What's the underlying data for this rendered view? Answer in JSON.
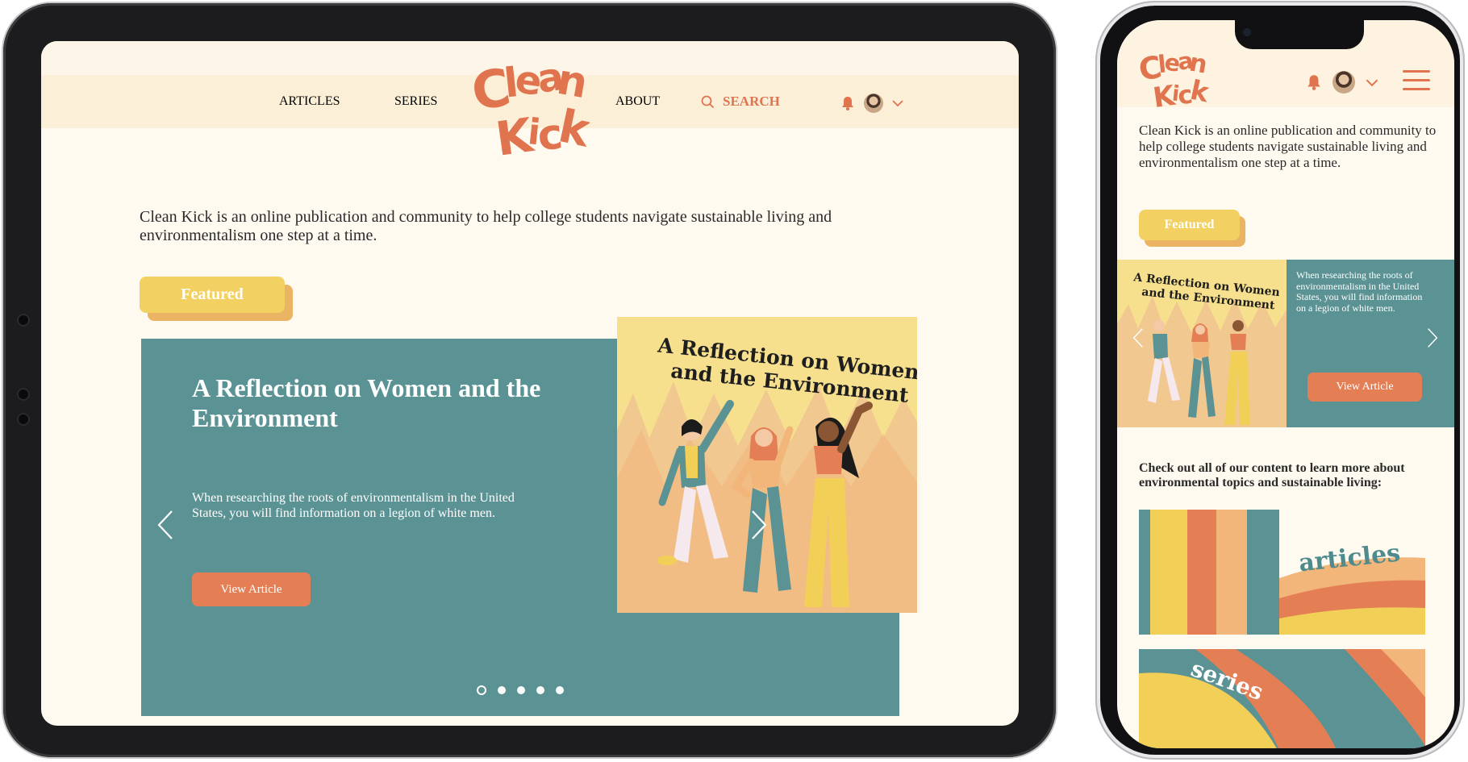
{
  "brand": {
    "logo_text": "Clean Kick"
  },
  "nav": {
    "articles": "ARTICLES",
    "series": "SERIES",
    "about": "ABOUT",
    "search": "SEARCH"
  },
  "intro": "Clean Kick is an online publication and community to help college students navigate sustainable living and environmentalism one step at a time.",
  "featured": {
    "label": "Featured",
    "title": "A Reflection on Women and the Environment",
    "art_title_line1": "A Reflection on Women",
    "art_title_line2": "and the Environment",
    "description": "When researching the roots of environmentalism in the United States, you will find information on a legion of white men.",
    "cta": "View Article",
    "slides": 5,
    "active_slide": 1
  },
  "content": {
    "prompt": "Check out all of our content to learn more about environmental topics and sustainable living:",
    "tiles": [
      {
        "label": "articles"
      },
      {
        "label": "series"
      }
    ]
  },
  "icons": [
    "bell-icon",
    "avatar",
    "chevron-down-icon",
    "search-icon",
    "menu-icon",
    "chevron-left-icon",
    "chevron-right-icon"
  ],
  "colors": {
    "accent": "#e0744e",
    "teal": "#5b9294",
    "featured": "#f2d062",
    "background": "#fffaf0",
    "nav": "#fcefd8"
  }
}
